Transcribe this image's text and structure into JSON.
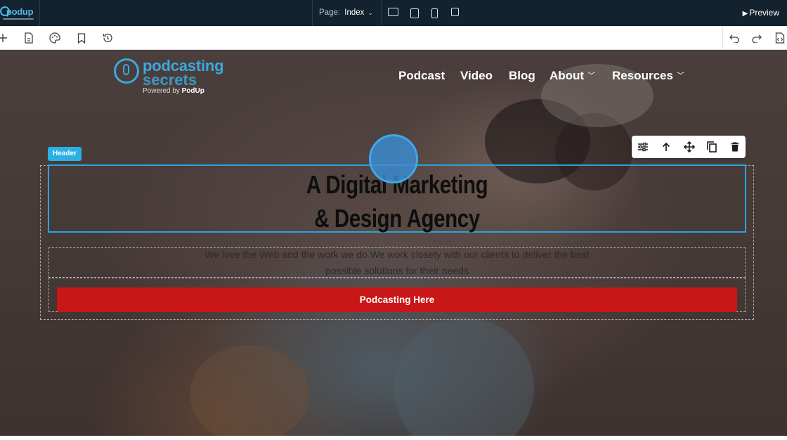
{
  "app": {
    "logo_text": "podup",
    "page_label": "Page:",
    "page_value": "Index",
    "devices": [
      "desktop-icon",
      "tablet-landscape-icon",
      "tablet-portrait-icon",
      "mobile-icon"
    ],
    "preview_label": "Preview"
  },
  "toolbar": {
    "left_icons": [
      "add-icon",
      "pages-icon",
      "palette-icon",
      "bookmark-icon",
      "history-icon"
    ],
    "right_icons": [
      "undo-icon",
      "redo-icon",
      "code-export-icon"
    ]
  },
  "site": {
    "logo_line1": "podcasting",
    "logo_line2": "secrets",
    "logo_powered": "Powered by",
    "logo_brand": "PodUp",
    "nav": [
      {
        "label": "Podcast"
      },
      {
        "label": "Video"
      },
      {
        "label": "Blog"
      },
      {
        "label": "About"
      },
      {
        "label": "Resources"
      }
    ]
  },
  "editor": {
    "selected_tag": "Header",
    "element_tools": [
      "settings-icon",
      "move-up-icon",
      "drag-icon",
      "duplicate-icon",
      "delete-icon"
    ]
  },
  "hero": {
    "heading_line1": "A Digital Marketing",
    "heading_line2": "& Design Agency",
    "subtext": "We love the Web and the work we do.We work closely with our clients to deliver the best possible solutions for their needs",
    "cta_label": "Podcasting Here"
  },
  "colors": {
    "topbar": "#12222e",
    "accent": "#2bb0e5",
    "cta": "#c81716"
  }
}
